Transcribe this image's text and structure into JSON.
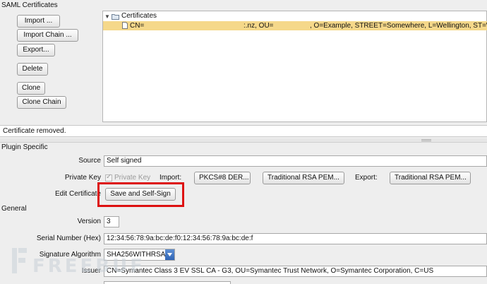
{
  "panel_title": "SAML Certificates",
  "buttons": {
    "import": "Import  ...",
    "import_chain": "Import Chain ...",
    "export": "Export...",
    "delete": "Delete",
    "clone": "Clone",
    "clone_chain": "Clone Chain"
  },
  "tree": {
    "root_label": "Certificates",
    "expander": "▼",
    "selected_item_cn": "CN=",
    "selected_item_mid": ":.nz, OU=",
    "selected_item_tail": ", O=Example, STREET=Somewhere, L=Wellington, ST=W"
  },
  "status_message": "Certificate removed.",
  "plugin": {
    "section_title": "Plugin Specific",
    "source_label": "Source",
    "source_value": "Self signed",
    "private_key_label": "Private Key",
    "private_key_checkbox_label": "Private Key",
    "private_key_checked": true,
    "import_label": "Import:",
    "pkcs8_button": "PKCS#8 DER...",
    "traditional_rsa_import_button": "Traditional RSA PEM...",
    "export_label": "Export:",
    "traditional_rsa_export_button": "Traditional RSA PEM...",
    "edit_certificate_label": "Edit Certificate",
    "save_self_sign_button": "Save and Self-Sign"
  },
  "general": {
    "section_title": "General",
    "version_label": "Version",
    "version_value": "3",
    "serial_label": "Serial Number (Hex)",
    "serial_value": "12:34:56:78:9a:bc:de:f0:12:34:56:78:9a:bc:de:f",
    "sig_alg_label": "Signature Algorithm",
    "sig_alg_value": "SHA256WITHRSA",
    "issuer_label": "Issuer",
    "issuer_value": "CN=Symantec Class 3 EV SSL CA - G3, OU=Symantec Trust Network, O=Symantec Corporation, C=US"
  },
  "watermark_text": "FREEBUF",
  "colors": {
    "selection_bg": "#f5d88a",
    "highlight_border": "#dd1111"
  }
}
